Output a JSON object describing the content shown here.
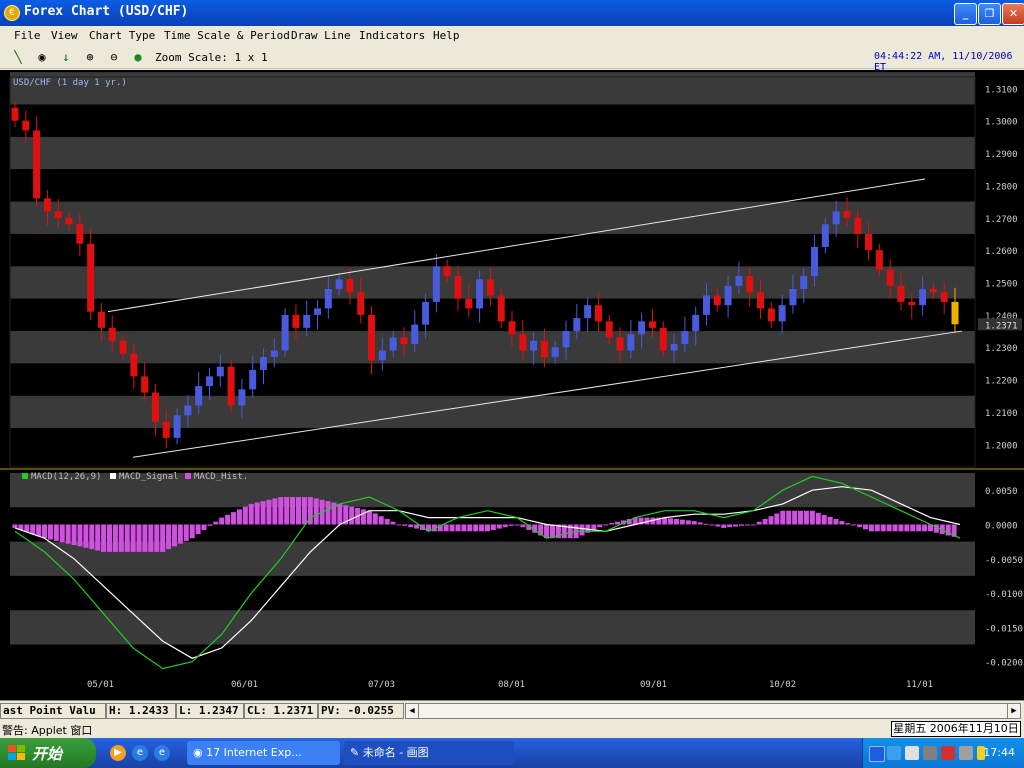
{
  "window": {
    "title": "Forex Chart  (USD/CHF)",
    "app_icon": "forex-app-icon",
    "controls": [
      "minimize",
      "maximize",
      "close"
    ]
  },
  "menu": [
    "File",
    "View",
    "Chart Type",
    "Time Scale & Period",
    "Draw Line",
    "Indicators",
    "Help"
  ],
  "toolbar": {
    "icons": [
      "draw-line-icon",
      "target-icon",
      "arrow-down-icon",
      "zoom-in-icon",
      "zoom-out-icon",
      "reset-icon"
    ],
    "zoom_label": "Zoom Scale: 1 x 1",
    "clock": "04:44:22 AM, 11/10/2006 ET"
  },
  "chart_data": [
    {
      "type": "candlestick",
      "title": "USD/CHF (1 day  1 yr.)",
      "ylim": [
        1.193,
        1.3135
      ],
      "y_ticks": [
        "1.3100",
        "1.3000",
        "1.2900",
        "1.2800",
        "1.2700",
        "1.2600",
        "1.2500",
        "1.2400",
        "1.2300",
        "1.2200",
        "1.2100",
        "1.2000"
      ],
      "current_price_label": "1.2371",
      "x_labels": [
        "05/01",
        "06/01",
        "07/03",
        "08/01",
        "09/01",
        "10/02",
        "11/01"
      ],
      "close_series": [
        1.3,
        1.297,
        1.276,
        1.272,
        1.27,
        1.268,
        1.262,
        1.241,
        1.236,
        1.232,
        1.228,
        1.221,
        1.216,
        1.207,
        1.202,
        1.209,
        1.212,
        1.218,
        1.221,
        1.224,
        1.212,
        1.217,
        1.223,
        1.227,
        1.229,
        1.24,
        1.236,
        1.24,
        1.242,
        1.248,
        1.251,
        1.247,
        1.24,
        1.226,
        1.229,
        1.233,
        1.231,
        1.237,
        1.244,
        1.255,
        1.252,
        1.245,
        1.242,
        1.251,
        1.246,
        1.238,
        1.234,
        1.229,
        1.232,
        1.227,
        1.23,
        1.235,
        1.239,
        1.243,
        1.238,
        1.233,
        1.229,
        1.234,
        1.238,
        1.236,
        1.229,
        1.231,
        1.235,
        1.24,
        1.246,
        1.243,
        1.249,
        1.252,
        1.247,
        1.242,
        1.238,
        1.243,
        1.248,
        1.252,
        1.261,
        1.268,
        1.272,
        1.27,
        1.265,
        1.26,
        1.254,
        1.249,
        1.244,
        1.243,
        1.248,
        1.247,
        1.244,
        1.2371
      ],
      "trendlines": [
        {
          "from": [
            "05/01",
            1.241
          ],
          "to": [
            "11/01",
            1.282
          ]
        },
        {
          "from": [
            "04/16",
            1.196
          ],
          "to": [
            "11/10",
            1.235
          ]
        }
      ]
    },
    {
      "type": "line",
      "title": "MACD",
      "legend": [
        "MACD(12,26,9)",
        "MACD_Signal",
        "MACD_Hist."
      ],
      "ylim": [
        -0.0215,
        0.0075
      ],
      "y_ticks": [
        "0.0050",
        "0.0000",
        "-0.0050",
        "-0.0100",
        "-0.0150",
        "-0.0200"
      ],
      "series": [
        {
          "name": "MACD(12,26,9)",
          "color": "#22cc22",
          "values": [
            -0.001,
            -0.004,
            -0.008,
            -0.013,
            -0.018,
            -0.021,
            -0.02,
            -0.016,
            -0.01,
            -0.005,
            0.001,
            0.003,
            0.004,
            0.002,
            -0.001,
            0.001,
            0.002,
            0.001,
            -0.002,
            -0.001,
            -0.001,
            0.001,
            0.002,
            0.002,
            0.001,
            0.002,
            0.005,
            0.007,
            0.006,
            0.004,
            0.002,
            0.0,
            -0.002
          ]
        },
        {
          "name": "MACD_Signal",
          "color": "#ffffff",
          "values": [
            -0.0005,
            -0.002,
            -0.005,
            -0.009,
            -0.013,
            -0.017,
            -0.0195,
            -0.018,
            -0.014,
            -0.009,
            -0.004,
            0.0,
            0.002,
            0.002,
            0.001,
            0.001,
            0.001,
            0.001,
            0.0,
            -0.0005,
            -0.001,
            0.0,
            0.001,
            0.0015,
            0.0015,
            0.002,
            0.003,
            0.005,
            0.0055,
            0.005,
            0.003,
            0.001,
            0.0
          ]
        },
        {
          "name": "MACD_Hist.",
          "color": "#d050e0",
          "values": [
            -0.0005,
            -0.002,
            -0.003,
            -0.004,
            -0.004,
            -0.004,
            -0.002,
            0.001,
            0.003,
            0.004,
            0.004,
            0.003,
            0.002,
            0.0,
            -0.001,
            -0.001,
            -0.001,
            0.0,
            -0.002,
            -0.002,
            0.0,
            0.001,
            0.001,
            0.0005,
            -0.0005,
            0.0,
            0.002,
            0.002,
            0.0005,
            -0.001,
            -0.001,
            -0.001,
            -0.002
          ]
        }
      ]
    }
  ],
  "status": {
    "last_point": "ast Point Valu",
    "high": "H: 1.2433",
    "low": "L: 1.2347",
    "close": "CL: 1.2371",
    "pv": "PV: -0.0255"
  },
  "warning": "警告: Applet 窗口",
  "date_box": "星期五 2006年11月10日",
  "taskbar": {
    "start_label": "开始",
    "tasks": [
      "17 Internet Exp...",
      "未命名 - 画图"
    ],
    "quick_launch": [
      "media-player-icon",
      "ie-icon",
      "ie-alt-icon"
    ],
    "tray_icons": [
      "help-icon",
      "network-icon",
      "sound-icon",
      "printer-icon",
      "security-icon",
      "monitor-icon",
      "volume-icon"
    ],
    "time": "17:44"
  }
}
